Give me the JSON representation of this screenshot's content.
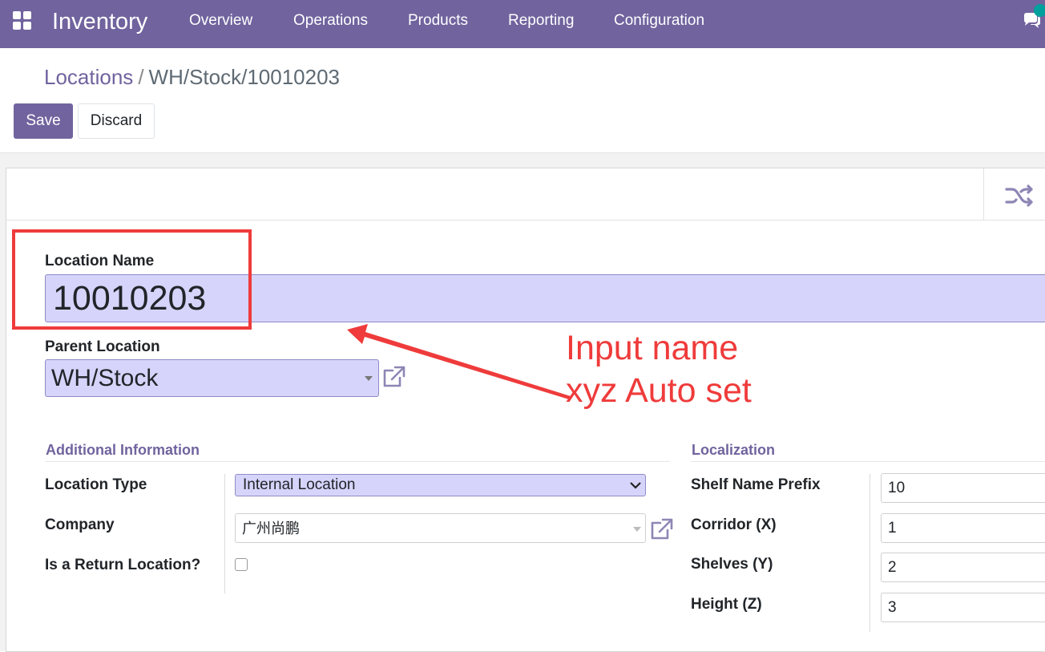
{
  "navbar": {
    "app_name": "Inventory",
    "menu": [
      "Overview",
      "Operations",
      "Products",
      "Reporting",
      "Configuration"
    ],
    "icons": [
      "apps-grid-icon",
      "chat-icon"
    ],
    "color": "#71639e"
  },
  "breadcrumb": {
    "parent": "Locations",
    "separator": "/",
    "current": "WH/Stock/10010203"
  },
  "buttons": {
    "save": "Save",
    "discard": "Discard"
  },
  "form": {
    "button_box_icon": "shuffle-icon",
    "location_name": {
      "label": "Location Name",
      "value": "10010203"
    },
    "parent_location": {
      "label": "Parent Location",
      "value": "WH/Stock"
    },
    "additional_information": {
      "title": "Additional Information",
      "location_type": {
        "label": "Location Type",
        "value": "Internal Location"
      },
      "company": {
        "label": "Company",
        "value": "广州尚鹏"
      },
      "return_location": {
        "label": "Is a Return Location?",
        "checked": false
      }
    },
    "localization": {
      "title": "Localization",
      "shelf_name_prefix": {
        "label": "Shelf Name Prefix",
        "value": "10"
      },
      "corridor": {
        "label": "Corridor (X)",
        "value": "1"
      },
      "shelves": {
        "label": "Shelves (Y)",
        "value": "2"
      },
      "height": {
        "label": "Height (Z)",
        "value": "3"
      }
    }
  },
  "annotation": {
    "line1": "Input name",
    "line2": "xyz Auto set",
    "color": "#ef3b3b"
  }
}
